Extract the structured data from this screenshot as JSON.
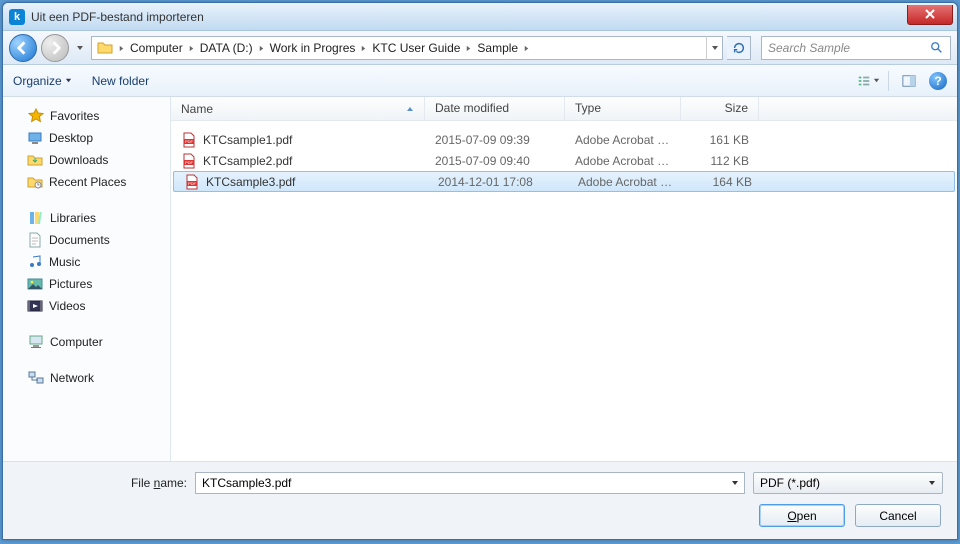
{
  "window": {
    "title": "Uit een PDF-bestand importeren"
  },
  "breadcrumb": {
    "items": [
      "Computer",
      "DATA (D:)",
      "Work in Progres",
      "KTC User Guide",
      "Sample"
    ]
  },
  "search": {
    "placeholder": "Search Sample"
  },
  "toolbar": {
    "organize": "Organize",
    "new_folder": "New folder"
  },
  "sidebar": {
    "favorites": {
      "label": "Favorites",
      "items": [
        "Desktop",
        "Downloads",
        "Recent Places"
      ]
    },
    "libraries": {
      "label": "Libraries",
      "items": [
        "Documents",
        "Music",
        "Pictures",
        "Videos"
      ]
    },
    "computer": {
      "label": "Computer"
    },
    "network": {
      "label": "Network"
    }
  },
  "columns": {
    "name": "Name",
    "date": "Date modified",
    "type": "Type",
    "size": "Size"
  },
  "files": [
    {
      "name": "KTCsample1.pdf",
      "date": "2015-07-09 09:39",
      "type": "Adobe Acrobat D...",
      "size": "161 KB",
      "selected": false
    },
    {
      "name": "KTCsample2.pdf",
      "date": "2015-07-09 09:40",
      "type": "Adobe Acrobat D...",
      "size": "112 KB",
      "selected": false
    },
    {
      "name": "KTCsample3.pdf",
      "date": "2014-12-01 17:08",
      "type": "Adobe Acrobat D...",
      "size": "164 KB",
      "selected": true
    }
  ],
  "footer": {
    "filename_label_pre": "File ",
    "filename_label_u": "n",
    "filename_label_post": "ame:",
    "filename_value": "KTCsample3.pdf",
    "filter": "PDF (*.pdf)",
    "open_u": "O",
    "open_post": "pen",
    "cancel": "Cancel"
  }
}
